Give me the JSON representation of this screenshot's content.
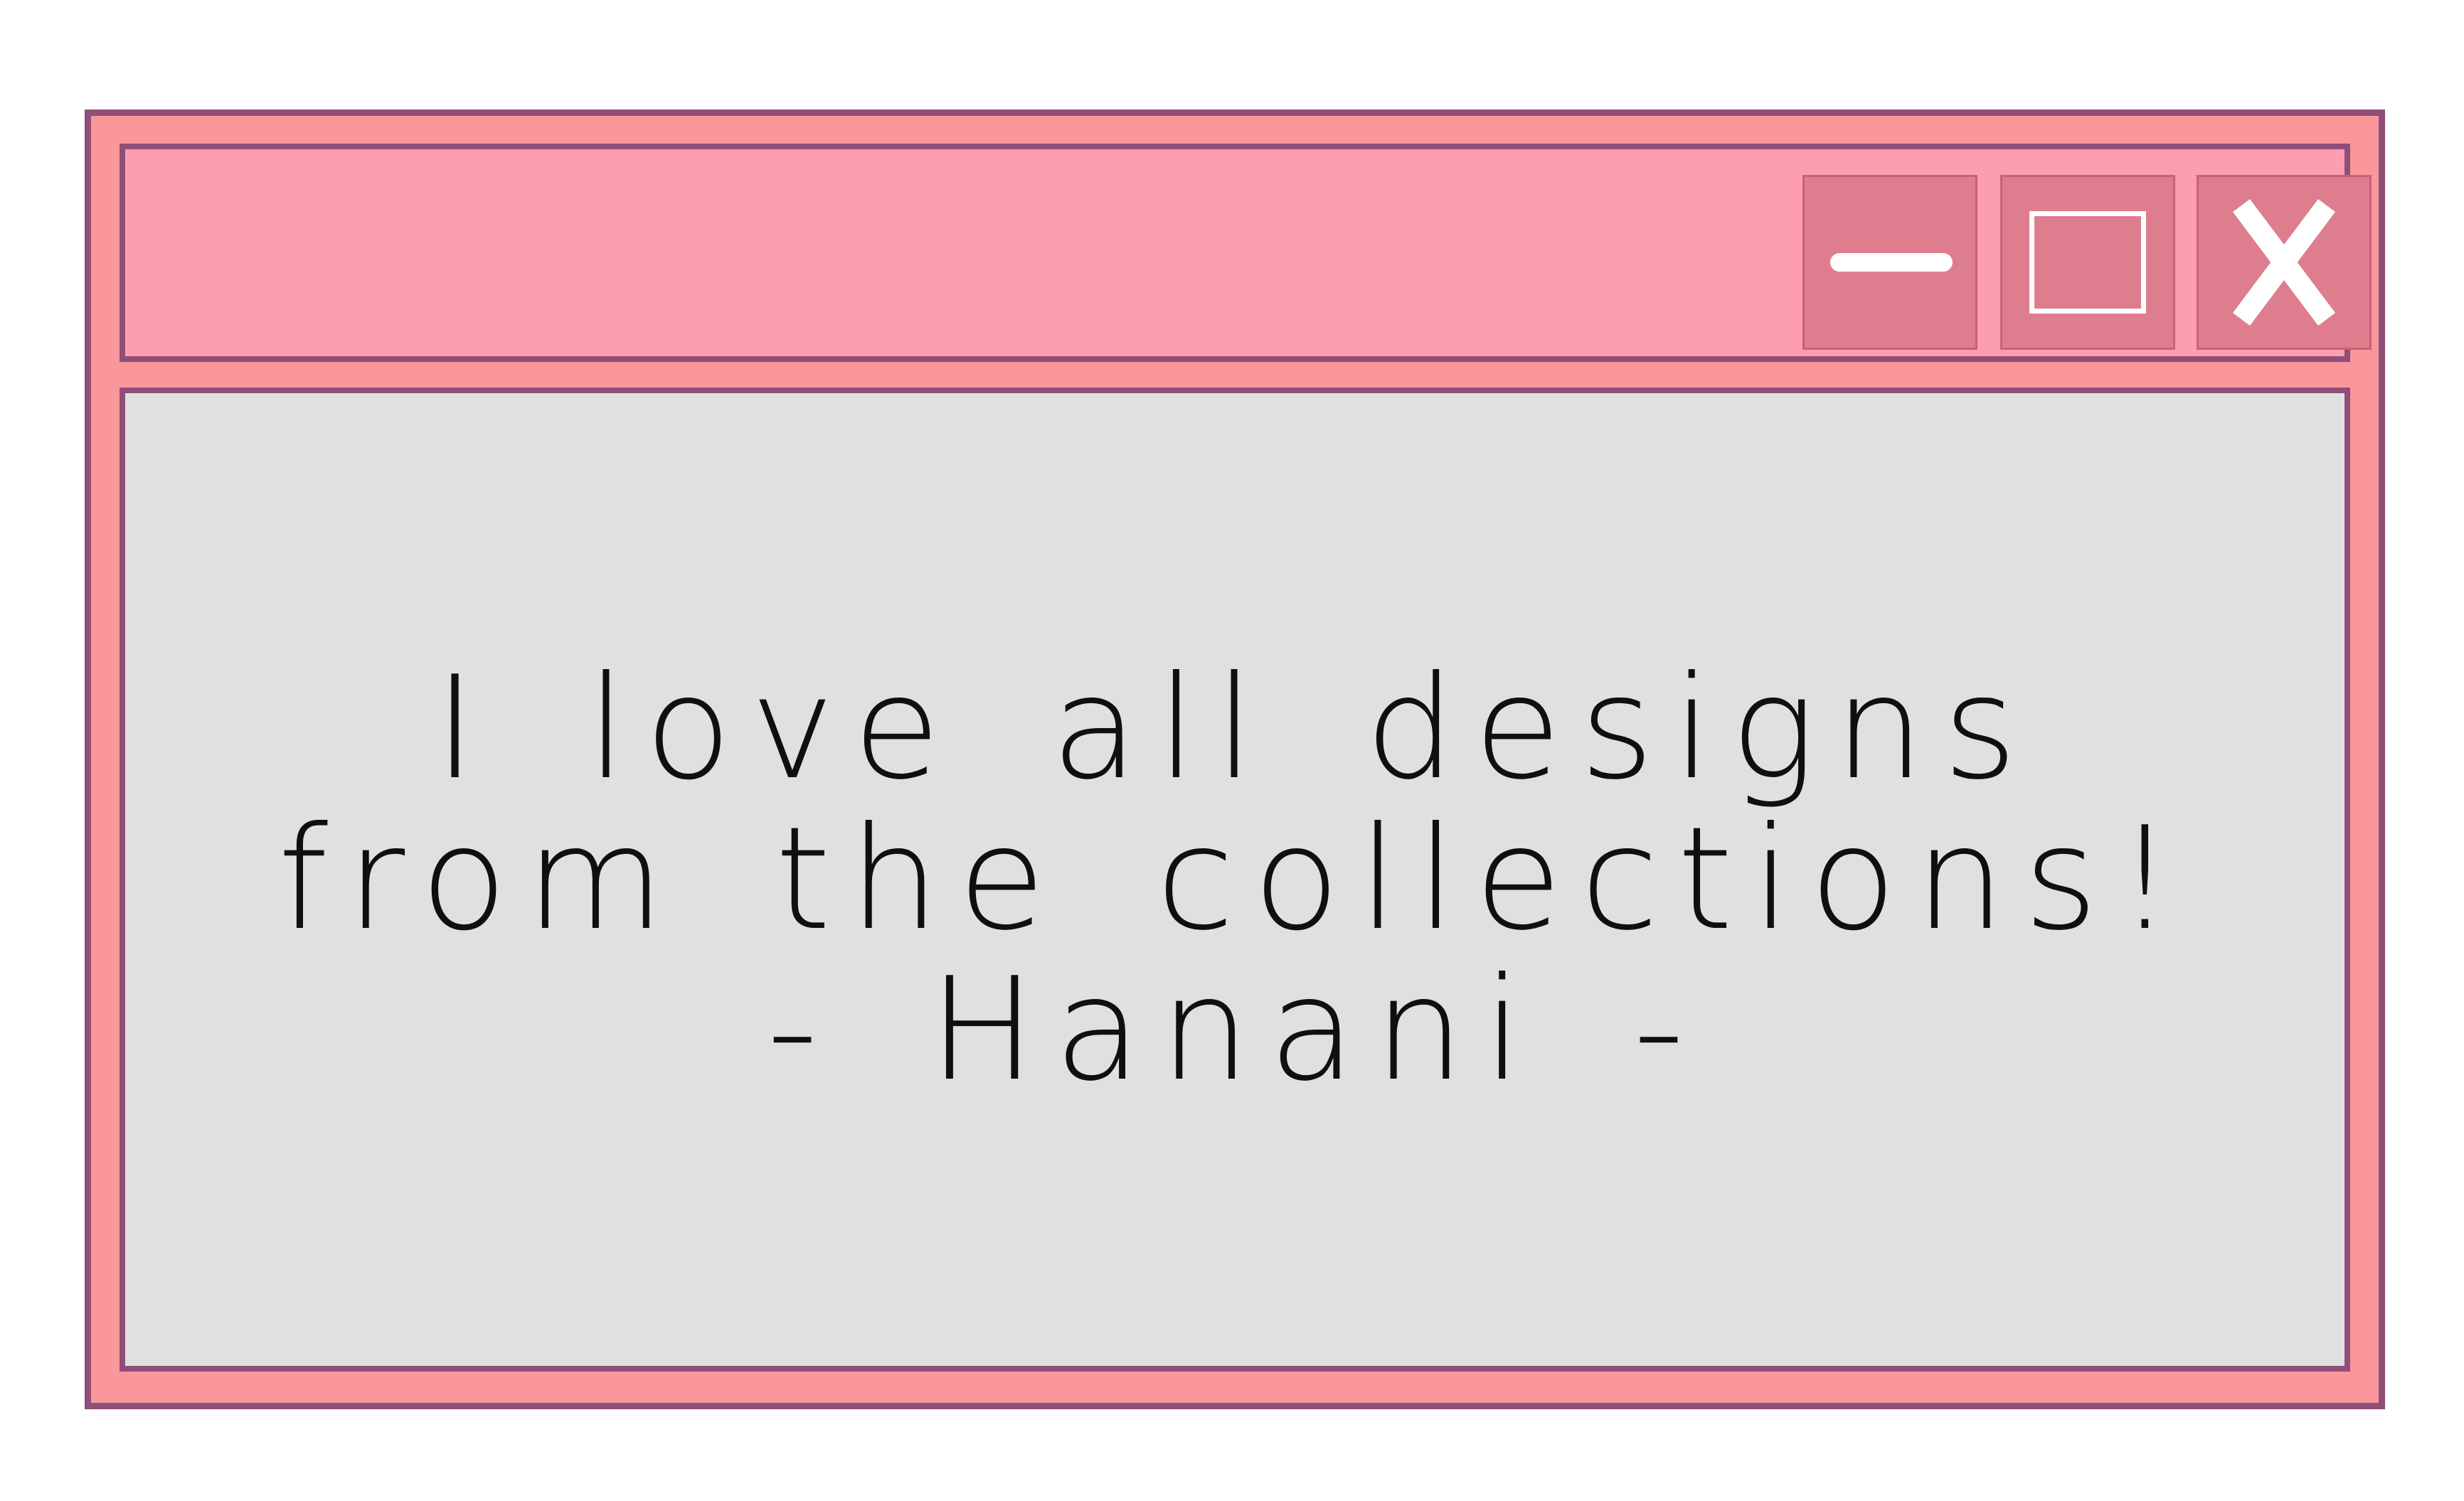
{
  "window": {
    "title": "",
    "controls": {
      "minimize_icon": "minimize-icon",
      "maximize_icon": "maximize-icon",
      "close_icon": "close-icon",
      "close_label": "X"
    }
  },
  "content": {
    "lines": [
      "I love all designs",
      "from the collections!",
      "- Hanani -"
    ]
  },
  "colors": {
    "frame": "#f9979a",
    "border": "#8f4f78",
    "titlebar": "#fd9eb0",
    "buttons": "#de7d8e",
    "content_bg": "#e0e0e0",
    "text": "#0f0f0f"
  }
}
